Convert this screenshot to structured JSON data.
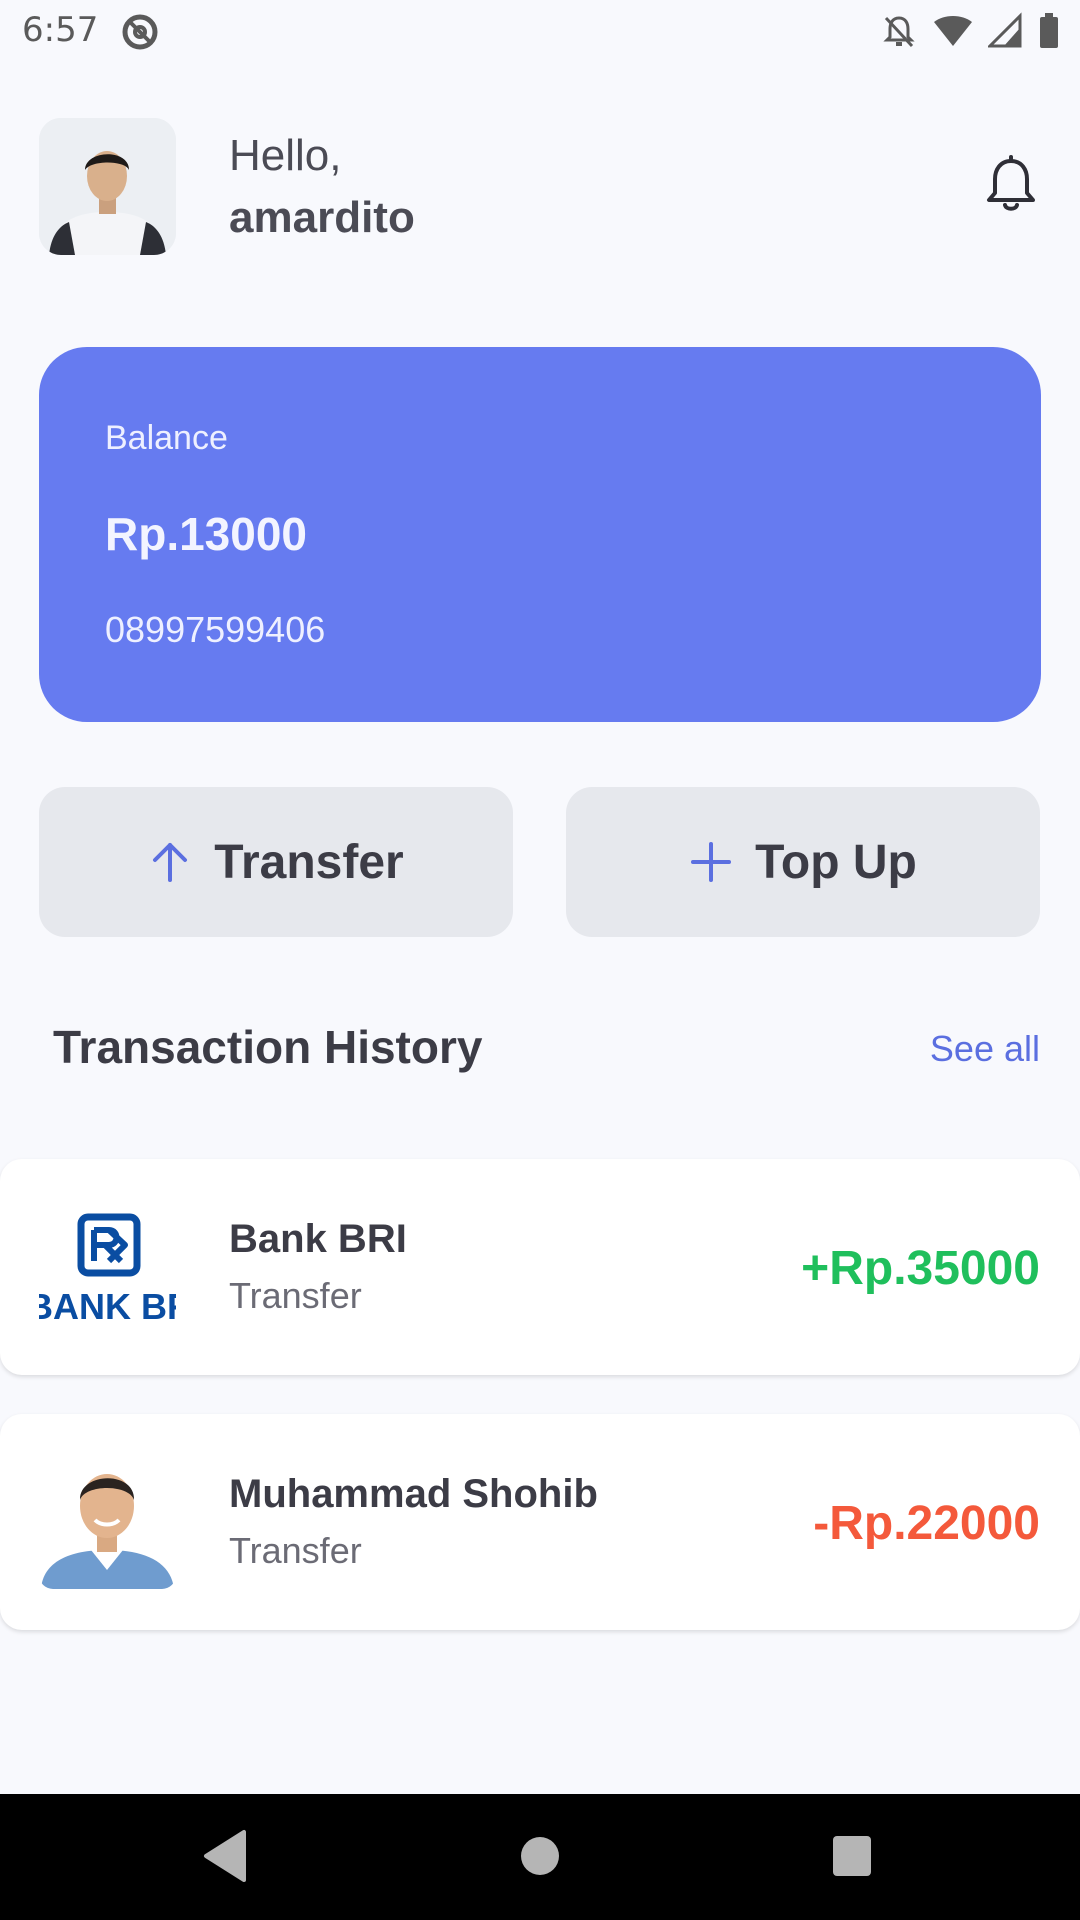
{
  "status_bar": {
    "time": "6:57",
    "at_icon": "at-sign-icon",
    "icons": [
      "bell-off-icon",
      "wifi-icon",
      "signal-icon",
      "battery-icon"
    ]
  },
  "header": {
    "greeting": "Hello,",
    "username": "amardito",
    "avatar_icon": "user-avatar",
    "notification_icon": "bell-icon"
  },
  "balance_card": {
    "label": "Balance",
    "amount": "Rp.13000",
    "phone": "08997599406",
    "color": "#667bf0"
  },
  "actions": {
    "transfer": {
      "label": "Transfer",
      "icon": "arrow-up-icon"
    },
    "top_up": {
      "label": "Top Up",
      "icon": "plus-icon"
    }
  },
  "history": {
    "title": "Transaction History",
    "see_all": "See all",
    "items": [
      {
        "name": "Bank BRI",
        "type": "Transfer",
        "amount": "+Rp.35000",
        "amount_color": "#1fbf5c",
        "logo": "bank-bri-logo"
      },
      {
        "name": "Muhammad Shohib",
        "type": "Transfer",
        "amount": "-Rp.22000",
        "amount_color": "#f4593b",
        "logo": "user-photo"
      }
    ]
  },
  "colors": {
    "accent": "#667bf0",
    "link": "#5b6fe0",
    "positive": "#1fbf5c",
    "negative": "#f4593b"
  }
}
